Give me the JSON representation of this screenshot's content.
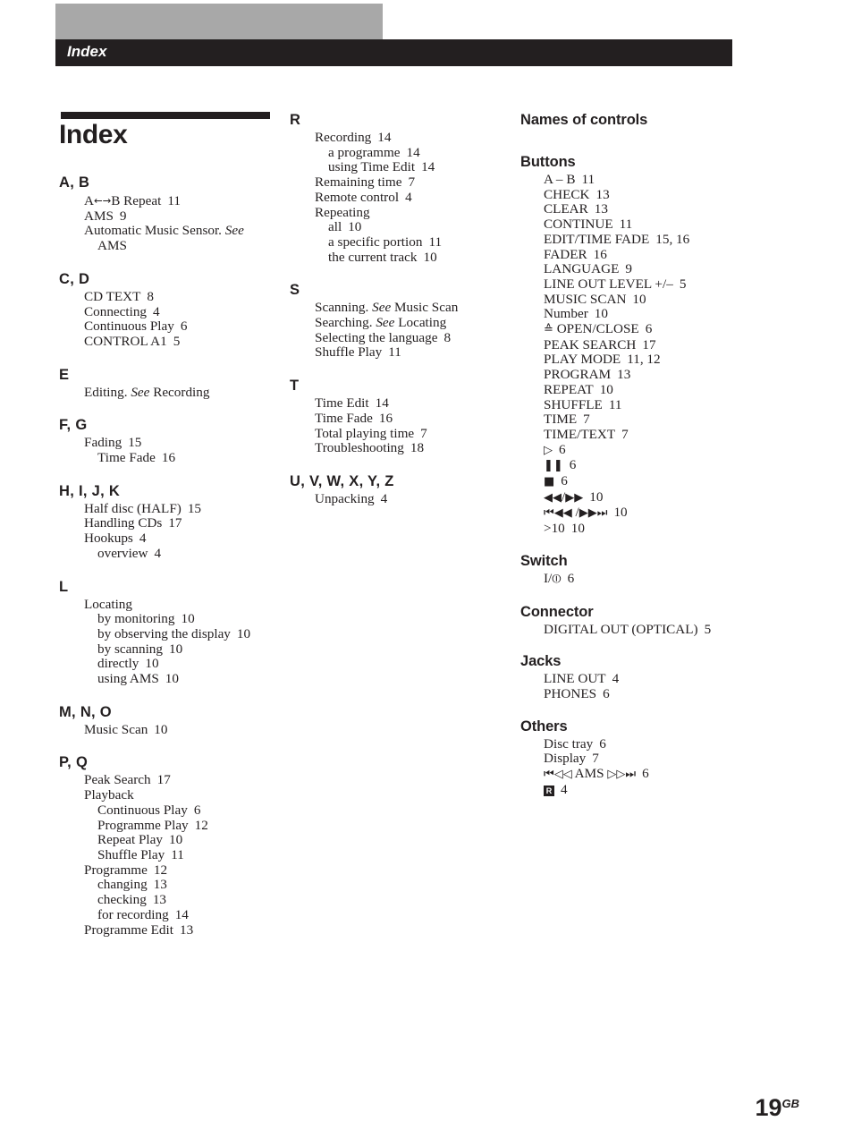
{
  "running_head": "Index",
  "page_title": "Index",
  "folio": {
    "number": "19",
    "suffix": "GB"
  },
  "colors": {
    "gray_bar": "#a8a8a8",
    "black_bar": "#231f20",
    "text": "#231f20"
  },
  "left_column": [
    {
      "letter": "A, B",
      "entries": [
        {
          "level": 0,
          "text": "A←→B Repeat",
          "page": "11"
        },
        {
          "level": 0,
          "text": "AMS",
          "page": "9"
        },
        {
          "level": 0,
          "text": "Automatic Music Sensor. See",
          "page": ""
        },
        {
          "level": 1,
          "text": "AMS",
          "page": ""
        }
      ]
    },
    {
      "letter": "C, D",
      "entries": [
        {
          "level": 0,
          "text": "CD TEXT",
          "page": "8"
        },
        {
          "level": 0,
          "text": "Connecting",
          "page": "4"
        },
        {
          "level": 0,
          "text": "Continuous Play",
          "page": "6"
        },
        {
          "level": 0,
          "text": "CONTROL A1",
          "page": "5"
        }
      ]
    },
    {
      "letter": "E",
      "entries": [
        {
          "level": 0,
          "text": "Editing. See Recording",
          "page": ""
        }
      ]
    },
    {
      "letter": "F, G",
      "entries": [
        {
          "level": 0,
          "text": "Fading",
          "page": "15"
        },
        {
          "level": 1,
          "text": "Time Fade",
          "page": "16"
        }
      ]
    },
    {
      "letter": "H, I, J, K",
      "entries": [
        {
          "level": 0,
          "text": "Half disc (HALF)",
          "page": "15"
        },
        {
          "level": 0,
          "text": "Handling CDs",
          "page": "17"
        },
        {
          "level": 0,
          "text": "Hookups",
          "page": "4"
        },
        {
          "level": 1,
          "text": "overview",
          "page": "4"
        }
      ]
    },
    {
      "letter": "L",
      "entries": [
        {
          "level": 0,
          "text": "Locating",
          "page": ""
        },
        {
          "level": 1,
          "text": "by monitoring",
          "page": "10"
        },
        {
          "level": 1,
          "text": "by observing the display",
          "page": "10"
        },
        {
          "level": 1,
          "text": "by scanning",
          "page": "10"
        },
        {
          "level": 1,
          "text": "directly",
          "page": "10"
        },
        {
          "level": 1,
          "text": "using AMS",
          "page": "10"
        }
      ]
    },
    {
      "letter": "M, N, O",
      "entries": [
        {
          "level": 0,
          "text": "Music Scan",
          "page": "10"
        }
      ]
    },
    {
      "letter": "P, Q",
      "entries": [
        {
          "level": 0,
          "text": "Peak Search",
          "page": "17"
        },
        {
          "level": 0,
          "text": "Playback",
          "page": ""
        },
        {
          "level": 1,
          "text": "Continuous Play",
          "page": "6"
        },
        {
          "level": 1,
          "text": "Programme Play",
          "page": "12"
        },
        {
          "level": 1,
          "text": "Repeat Play",
          "page": "10"
        },
        {
          "level": 1,
          "text": "Shuffle Play",
          "page": "11"
        },
        {
          "level": 0,
          "text": "Programme",
          "page": "12"
        },
        {
          "level": 1,
          "text": "changing",
          "page": "13"
        },
        {
          "level": 1,
          "text": "checking",
          "page": "13"
        },
        {
          "level": 1,
          "text": "for recording",
          "page": "14"
        },
        {
          "level": 0,
          "text": "Programme Edit",
          "page": "13"
        }
      ]
    }
  ],
  "middle_column": [
    {
      "letter": "R",
      "entries": [
        {
          "level": 0,
          "text": "Recording",
          "page": "14"
        },
        {
          "level": 1,
          "text": "a programme",
          "page": "14"
        },
        {
          "level": 1,
          "text": "using Time Edit",
          "page": "14"
        },
        {
          "level": 0,
          "text": "Remaining time",
          "page": "7"
        },
        {
          "level": 0,
          "text": "Remote control",
          "page": "4"
        },
        {
          "level": 0,
          "text": "Repeating",
          "page": ""
        },
        {
          "level": 1,
          "text": "all",
          "page": "10"
        },
        {
          "level": 1,
          "text": "a specific portion",
          "page": "11"
        },
        {
          "level": 1,
          "text": "the current track",
          "page": "10"
        }
      ]
    },
    {
      "letter": "S",
      "entries": [
        {
          "level": 0,
          "text": "Scanning. See Music Scan",
          "page": ""
        },
        {
          "level": 0,
          "text": "Searching. See Locating",
          "page": ""
        },
        {
          "level": 0,
          "text": "Selecting the language",
          "page": "8"
        },
        {
          "level": 0,
          "text": "Shuffle Play",
          "page": "11"
        }
      ]
    },
    {
      "letter": "T",
      "entries": [
        {
          "level": 0,
          "text": "Time Edit",
          "page": "14"
        },
        {
          "level": 0,
          "text": "Time Fade",
          "page": "16"
        },
        {
          "level": 0,
          "text": "Total playing time",
          "page": "7"
        },
        {
          "level": 0,
          "text": "Troubleshooting",
          "page": "18"
        }
      ]
    },
    {
      "letter": "U, V, W, X, Y, Z",
      "entries": [
        {
          "level": 0,
          "text": "Unpacking",
          "page": "4"
        }
      ]
    }
  ],
  "right_column": {
    "heading": "Names of controls",
    "sections": [
      {
        "title": "Buttons",
        "entries": [
          {
            "level": 0,
            "text": "A – B",
            "page": "11"
          },
          {
            "level": 0,
            "text": "CHECK",
            "page": "13"
          },
          {
            "level": 0,
            "text": "CLEAR",
            "page": "13"
          },
          {
            "level": 0,
            "text": "CONTINUE",
            "page": "11"
          },
          {
            "level": 0,
            "text": "EDIT/TIME FADE",
            "page": "15, 16"
          },
          {
            "level": 0,
            "text": "FADER",
            "page": "16"
          },
          {
            "level": 0,
            "text": "LANGUAGE",
            "page": "9"
          },
          {
            "level": 0,
            "text": "LINE OUT LEVEL +/–",
            "page": "5"
          },
          {
            "level": 0,
            "text": "MUSIC SCAN",
            "page": "10"
          },
          {
            "level": 0,
            "text": "Number",
            "page": "10"
          },
          {
            "level": 0,
            "text": "≙ OPEN/CLOSE",
            "page": "6",
            "icon": "eject-icon"
          },
          {
            "level": 0,
            "text": "PEAK SEARCH",
            "page": "17"
          },
          {
            "level": 0,
            "text": "PLAY MODE",
            "page": "11, 12"
          },
          {
            "level": 0,
            "text": "PROGRAM",
            "page": "13"
          },
          {
            "level": 0,
            "text": "REPEAT",
            "page": "10"
          },
          {
            "level": 0,
            "text": "SHUFFLE",
            "page": "11"
          },
          {
            "level": 0,
            "text": "TIME",
            "page": "7"
          },
          {
            "level": 0,
            "text": "TIME/TEXT",
            "page": "7"
          },
          {
            "level": 0,
            "text": "▷",
            "page": "6",
            "icon": "play-icon"
          },
          {
            "level": 0,
            "text": "❚❚",
            "page": "6",
            "icon": "pause-icon"
          },
          {
            "level": 0,
            "text": "■",
            "page": "6",
            "icon": "stop-icon"
          },
          {
            "level": 0,
            "text": "◀◀/▶▶",
            "page": "10",
            "icon": "rewind-forward-icon"
          },
          {
            "level": 0,
            "text": "⏮◀◀ /▶▶⏭",
            "page": "10",
            "icon": "skip-prev-next-icon"
          },
          {
            "level": 0,
            "text": ">10",
            "page": "10"
          }
        ]
      },
      {
        "title": "Switch",
        "entries": [
          {
            "level": 0,
            "text": "I/⏼",
            "page": "6",
            "icon": "power-icon"
          }
        ]
      },
      {
        "title": "Connector",
        "entries": [
          {
            "level": 0,
            "text": "DIGITAL OUT (OPTICAL)",
            "page": "5"
          }
        ]
      },
      {
        "title": "Jacks",
        "entries": [
          {
            "level": 0,
            "text": "LINE OUT",
            "page": "4"
          },
          {
            "level": 0,
            "text": "PHONES",
            "page": "6"
          }
        ]
      },
      {
        "title": "Others",
        "entries": [
          {
            "level": 0,
            "text": "Disc tray",
            "page": "6"
          },
          {
            "level": 0,
            "text": "Display",
            "page": "7"
          },
          {
            "level": 0,
            "text": "⏮◁◁ AMS ▷▷⏭",
            "page": "6",
            "icon": "ams-icon"
          },
          {
            "level": 0,
            "text": "R",
            "page": "4",
            "icon": "remote-sensor-icon",
            "boxed": true
          }
        ]
      }
    ]
  }
}
